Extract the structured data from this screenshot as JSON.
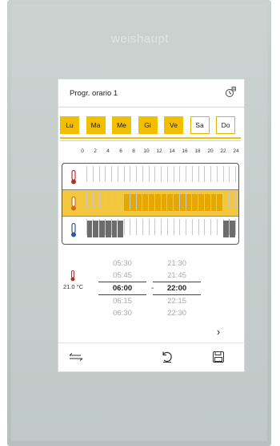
{
  "brand": "weishaupt",
  "header": {
    "title": "Progr. orario 1",
    "clock_icon": "clock-calendar-icon"
  },
  "days": [
    {
      "label": "Lu",
      "active": true
    },
    {
      "label": "Ma",
      "active": true
    },
    {
      "label": "Me",
      "active": true
    },
    {
      "label": "Gi",
      "active": true
    },
    {
      "label": "Ve",
      "active": true
    },
    {
      "label": "Sa",
      "active": false
    },
    {
      "label": "Do",
      "active": false
    }
  ],
  "hours": [
    "0",
    "2",
    "4",
    "6",
    "8",
    "10",
    "12",
    "14",
    "16",
    "18",
    "20",
    "22",
    "24"
  ],
  "rows": [
    {
      "icon": "thermometer-red-icon",
      "color": "#b5322a",
      "blocks": []
    },
    {
      "icon": "thermometer-orange-icon",
      "color": "#d36b14",
      "blocks": [
        [
          6,
          22
        ]
      ],
      "fill": "#e4a800",
      "band": "#f4c740"
    },
    {
      "icon": "thermometer-blue-icon",
      "color": "#2a5aa0",
      "blocks": [
        [
          0,
          6
        ],
        [
          22,
          24
        ]
      ],
      "fill": "#6c6c6c"
    }
  ],
  "start_times": [
    "05:30",
    "05:45",
    "06:00",
    "06:15",
    "06:30"
  ],
  "end_times": [
    "21:30",
    "21:45",
    "22:00",
    "22:15",
    "22:30"
  ],
  "separator": "-",
  "set_temperature": "21.0 °C",
  "buttons": {
    "next": "›",
    "back": "⇜",
    "undo": "↺",
    "save": "💾"
  }
}
